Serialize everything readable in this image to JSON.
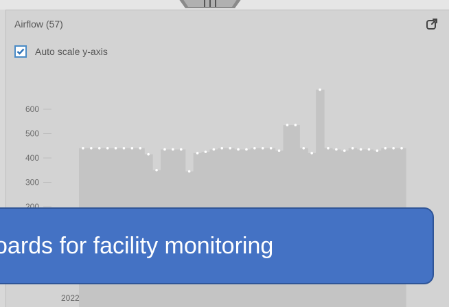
{
  "panel": {
    "title": "Airflow (57)",
    "auto_scale_label": "Auto scale y-axis",
    "auto_scale_checked": true
  },
  "chart_data": {
    "type": "area",
    "step": true,
    "y_ticks": [
      600,
      500,
      400,
      300,
      200
    ],
    "ylim": [
      150,
      700
    ],
    "x_label": "2022",
    "values": [
      440,
      440,
      440,
      440,
      440,
      440,
      440,
      440,
      415,
      350,
      435,
      435,
      435,
      345,
      420,
      425,
      435,
      440,
      440,
      435,
      435,
      440,
      440,
      440,
      430,
      535,
      535,
      440,
      420,
      680,
      440,
      435,
      430,
      440,
      435,
      435,
      430,
      440,
      440,
      440
    ],
    "colors": {
      "area": "#c4c4c4",
      "point": "#ffffff"
    }
  },
  "banner": {
    "text": "oards for facility monitoring"
  }
}
